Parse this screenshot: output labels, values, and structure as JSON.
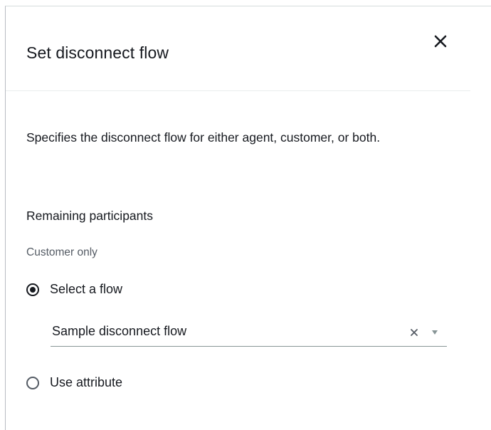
{
  "dialog": {
    "title": "Set disconnect flow",
    "close_icon": "close-icon",
    "description": "Specifies the disconnect flow for either agent, customer, or both."
  },
  "remaining_participants": {
    "label": "Remaining participants",
    "sub_label": "Customer only"
  },
  "options": {
    "select_flow": {
      "label": "Select a flow",
      "checked": true
    },
    "flow_dropdown": {
      "value": "Sample disconnect flow",
      "clear_icon": "clear-icon",
      "caret_icon": "caret-down-icon"
    },
    "use_attribute": {
      "label": "Use attribute",
      "checked": false
    }
  }
}
